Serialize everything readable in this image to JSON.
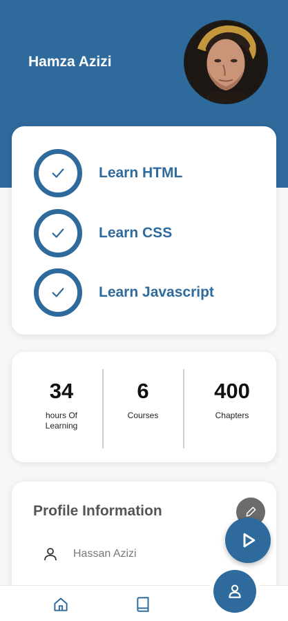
{
  "header": {
    "user_name": "Hamza Azizi",
    "avatar_icon": "user-photo-avatar",
    "background_color": "#2f6a9c"
  },
  "courses": [
    {
      "label": "Learn HTML",
      "icon": "check-icon",
      "completed": true
    },
    {
      "label": "Learn CSS",
      "icon": "check-icon",
      "completed": true
    },
    {
      "label": "Learn Javascript",
      "icon": "check-icon",
      "completed": true
    }
  ],
  "stats": [
    {
      "value": "34",
      "label": "hours Of Learning"
    },
    {
      "value": "6",
      "label": "Courses"
    },
    {
      "value": "400",
      "label": "Chapters"
    }
  ],
  "profile": {
    "title": "Profile Information",
    "edit_icon": "pencil-icon",
    "rows": [
      {
        "icon": "person-icon",
        "value": "Hassan Azizi"
      }
    ]
  },
  "fab": {
    "icon": "play-icon"
  },
  "bottom_nav": {
    "items": [
      {
        "icon": "home-icon",
        "active": false
      },
      {
        "icon": "book-icon",
        "active": false
      },
      {
        "icon": "profile-icon",
        "active": true
      }
    ]
  },
  "colors": {
    "accent": "#2f6a9c",
    "card": "#ffffff",
    "background": "#f7f7f7"
  }
}
